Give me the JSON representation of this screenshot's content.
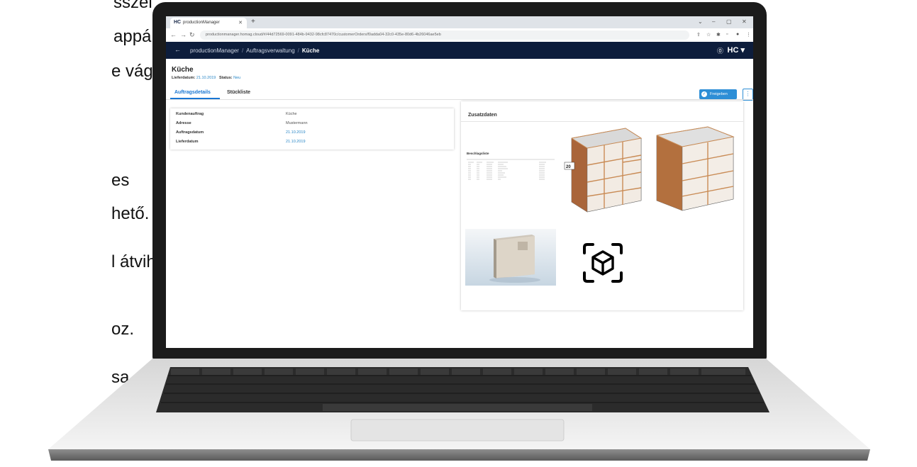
{
  "side_text": [
    "sszel",
    "appához",
    "e vágási",
    "es",
    "hető.",
    "l átvihető az",
    "oz.",
    "sa"
  ],
  "browser": {
    "tab_title": "productionManager",
    "favicon": "HC",
    "url": "productionmanager.homag.cloud/#/44d72569-0091-484b-9432-98cfc87470c/customerOrders/f0adda04-32c0-435e-80d6-4b26046ae5eb"
  },
  "app": {
    "breadcrumbs": [
      "productionManager",
      "Auftragsverwaltung",
      "Küche"
    ],
    "logo": "HC"
  },
  "page": {
    "title": "Küche",
    "delivery_label": "Lieferdatum:",
    "delivery_value": "21.10.2019",
    "status_label": "Status:",
    "status_value": "Neu",
    "release_button": "Freigeben",
    "more_button": "⋮"
  },
  "tabs": [
    "Auftragsdetails",
    "Stückliste"
  ],
  "details": [
    {
      "label": "Kundenauftrag",
      "value": "Küche"
    },
    {
      "label": "Adresse",
      "value": "Mustermann"
    },
    {
      "label": "Auftragsdatum",
      "value": "21.10.2019"
    },
    {
      "label": "Lieferdatum",
      "value": "21.10.2019"
    }
  ],
  "zusatz": {
    "title": "Zusatzdaten",
    "doc_title": "Beschlagsliste",
    "dim_label": "20"
  },
  "icons": {
    "back": "arrow-left-icon",
    "help": "help-circle-icon",
    "ar": "ar-cube-icon",
    "check": "check-circle-icon"
  }
}
